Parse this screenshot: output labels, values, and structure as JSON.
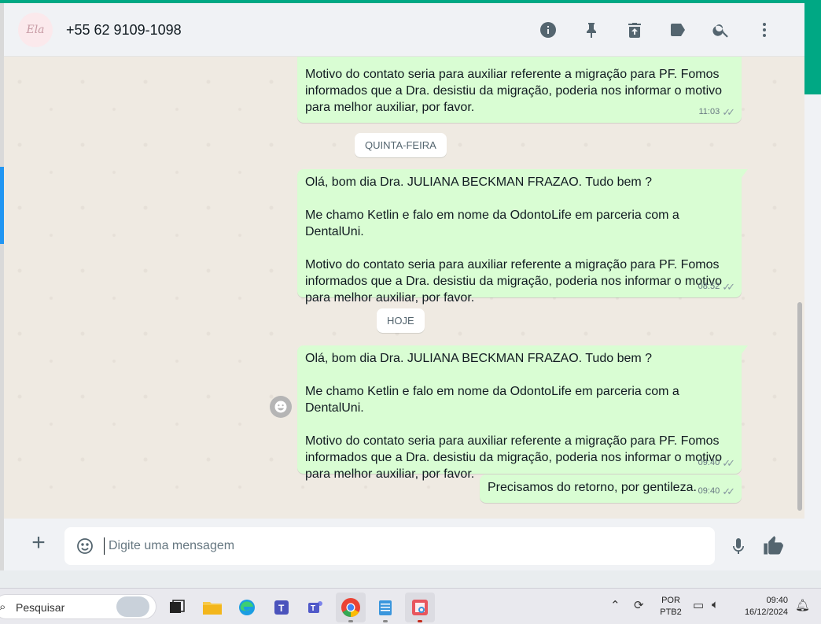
{
  "header": {
    "avatar_text": "Ela",
    "contact_name": "+55 62 9109-1098",
    "icons": [
      "info-icon",
      "pin-icon",
      "delete-icon",
      "label-icon",
      "search-icon",
      "menu-icon"
    ]
  },
  "messages": [
    {
      "lines": [
        "Motivo do contato seria para auxiliar referente a migração para PF. Fomos",
        "informados que a Dra. desistiu da migração, poderia nos informar o motivo",
        "para melhor auxiliar, por favor."
      ],
      "time": "11:03"
    },
    {
      "greeting": "Olá, bom dia Dra. JULIANA BECKMAN FRAZAO. Tudo bem ?",
      "intro": "Me chamo Ketlin e falo em nome da OdontoLife em parceria com a DentalUni.",
      "lines": [
        "Motivo do contato seria para auxiliar referente a migração para PF. Fomos",
        "informados que a Dra. desistiu da migração, poderia nos informar o motivo",
        "para melhor auxiliar, por favor."
      ],
      "time": "08:52"
    },
    {
      "greeting": "Olá, bom dia Dra. JULIANA BECKMAN FRAZAO. Tudo bem ?",
      "intro": "Me chamo Ketlin e falo em nome da OdontoLife em parceria com a DentalUni.",
      "lines": [
        "Motivo do contato seria para auxiliar referente a migração para PF. Fomos",
        "informados que a Dra. desistiu da migração, poderia nos informar o motivo",
        "para melhor auxiliar, por favor."
      ],
      "time": "09:40"
    },
    {
      "text": "Precisamos do retorno, por gentileza.",
      "time": "09:40"
    }
  ],
  "date_chips": [
    "QUINTA-FEIRA",
    "HOJE"
  ],
  "composer": {
    "placeholder": "Digite uma mensagem"
  },
  "taskbar": {
    "search_label": "Pesquisar",
    "language": "POR",
    "layout": "PTB2",
    "time": "09:40",
    "date": "16/12/2024"
  },
  "colors": {
    "accent": "#00a884",
    "outgoing_bubble": "#d9fdd3",
    "chat_background": "#efeae2"
  }
}
